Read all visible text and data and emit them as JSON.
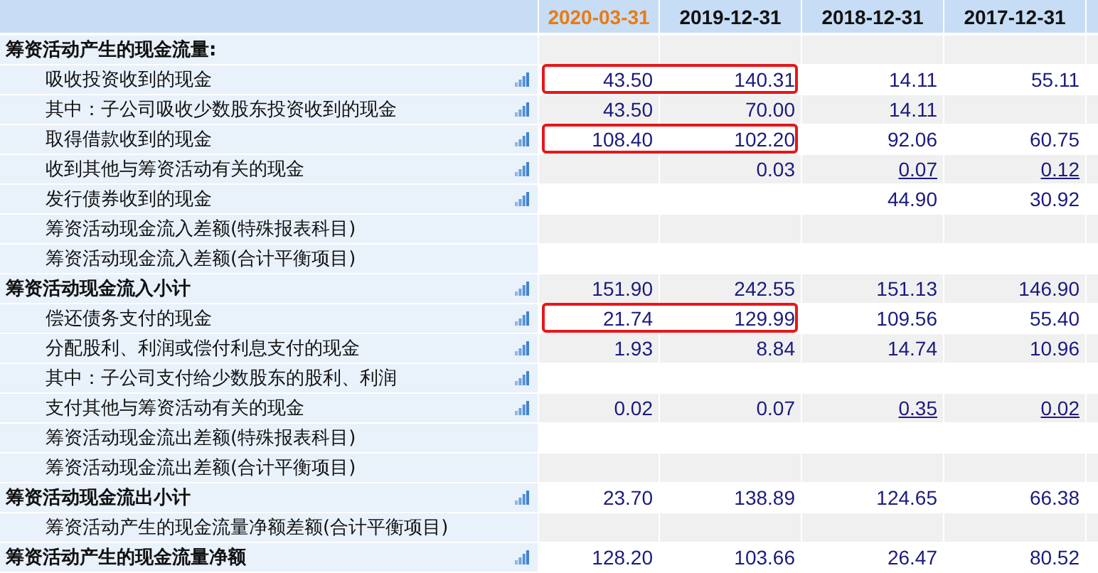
{
  "columns": [
    {
      "label": "2020-03-31",
      "selected": true
    },
    {
      "label": "2019-12-31",
      "selected": false
    },
    {
      "label": "2018-12-31",
      "selected": false
    },
    {
      "label": "2017-12-31",
      "selected": false
    }
  ],
  "rows": [
    {
      "kind": "section",
      "label": "筹资活动产生的现金流量:",
      "chart_icon": false,
      "highlighted": false,
      "cells": [
        null,
        null,
        null,
        null
      ]
    },
    {
      "kind": "item",
      "label": "吸收投资收到的现金",
      "chart_icon": true,
      "highlighted": true,
      "cells": [
        {
          "text": "43.50",
          "link": false
        },
        {
          "text": "140.31",
          "link": false
        },
        {
          "text": "14.11",
          "link": false
        },
        {
          "text": "55.11",
          "link": false
        }
      ]
    },
    {
      "kind": "item",
      "label": "其中：子公司吸收少数股东投资收到的现金",
      "chart_icon": true,
      "highlighted": false,
      "cells": [
        {
          "text": "43.50",
          "link": false
        },
        {
          "text": "70.00",
          "link": false
        },
        {
          "text": "14.11",
          "link": false
        },
        null
      ]
    },
    {
      "kind": "item",
      "label": "取得借款收到的现金",
      "chart_icon": true,
      "highlighted": true,
      "cells": [
        {
          "text": "108.40",
          "link": false
        },
        {
          "text": "102.20",
          "link": false
        },
        {
          "text": "92.06",
          "link": false
        },
        {
          "text": "60.75",
          "link": false
        }
      ]
    },
    {
      "kind": "item",
      "label": "收到其他与筹资活动有关的现金",
      "chart_icon": true,
      "highlighted": false,
      "cells": [
        null,
        {
          "text": "0.03",
          "link": false
        },
        {
          "text": "0.07",
          "link": true
        },
        {
          "text": "0.12",
          "link": true
        }
      ]
    },
    {
      "kind": "item",
      "label": "发行债券收到的现金",
      "chart_icon": true,
      "highlighted": false,
      "cells": [
        null,
        null,
        {
          "text": "44.90",
          "link": false
        },
        {
          "text": "30.92",
          "link": false
        }
      ]
    },
    {
      "kind": "item",
      "label": "筹资活动现金流入差额(特殊报表科目)",
      "chart_icon": false,
      "highlighted": false,
      "cells": [
        null,
        null,
        null,
        null
      ]
    },
    {
      "kind": "item",
      "label": "筹资活动现金流入差额(合计平衡项目)",
      "chart_icon": false,
      "highlighted": false,
      "cells": [
        null,
        null,
        null,
        null
      ]
    },
    {
      "kind": "subtotal",
      "label": "筹资活动现金流入小计",
      "chart_icon": true,
      "highlighted": false,
      "cells": [
        {
          "text": "151.90",
          "link": false
        },
        {
          "text": "242.55",
          "link": false
        },
        {
          "text": "151.13",
          "link": false
        },
        {
          "text": "146.90",
          "link": false
        }
      ]
    },
    {
      "kind": "item",
      "label": "偿还债务支付的现金",
      "chart_icon": true,
      "highlighted": true,
      "cells": [
        {
          "text": "21.74",
          "link": false
        },
        {
          "text": "129.99",
          "link": false
        },
        {
          "text": "109.56",
          "link": false
        },
        {
          "text": "55.40",
          "link": false
        }
      ]
    },
    {
      "kind": "item",
      "label": "分配股利、利润或偿付利息支付的现金",
      "chart_icon": true,
      "highlighted": false,
      "cells": [
        {
          "text": "1.93",
          "link": false
        },
        {
          "text": "8.84",
          "link": false
        },
        {
          "text": "14.74",
          "link": false
        },
        {
          "text": "10.96",
          "link": false
        }
      ]
    },
    {
      "kind": "item",
      "label": "其中：子公司支付给少数股东的股利、利润",
      "chart_icon": true,
      "highlighted": false,
      "cells": [
        null,
        null,
        null,
        null
      ]
    },
    {
      "kind": "item",
      "label": "支付其他与筹资活动有关的现金",
      "chart_icon": true,
      "highlighted": false,
      "cells": [
        {
          "text": "0.02",
          "link": false
        },
        {
          "text": "0.07",
          "link": false
        },
        {
          "text": "0.35",
          "link": true
        },
        {
          "text": "0.02",
          "link": true
        }
      ]
    },
    {
      "kind": "item",
      "label": "筹资活动现金流出差额(特殊报表科目)",
      "chart_icon": false,
      "highlighted": false,
      "cells": [
        null,
        null,
        null,
        null
      ]
    },
    {
      "kind": "item",
      "label": "筹资活动现金流出差额(合计平衡项目)",
      "chart_icon": false,
      "highlighted": false,
      "cells": [
        null,
        null,
        null,
        null
      ]
    },
    {
      "kind": "subtotal",
      "label": "筹资活动现金流出小计",
      "chart_icon": true,
      "highlighted": false,
      "cells": [
        {
          "text": "23.70",
          "link": false
        },
        {
          "text": "138.89",
          "link": false
        },
        {
          "text": "124.65",
          "link": false
        },
        {
          "text": "66.38",
          "link": false
        }
      ]
    },
    {
      "kind": "item",
      "label": "筹资活动产生的现金流量净额差额(合计平衡项目)",
      "chart_icon": false,
      "highlighted": false,
      "cells": [
        null,
        null,
        null,
        null
      ]
    },
    {
      "kind": "subtotal",
      "label": "筹资活动产生的现金流量净额",
      "chart_icon": true,
      "highlighted": false,
      "cells": [
        {
          "text": "128.20",
          "link": false
        },
        {
          "text": "103.66",
          "link": false
        },
        {
          "text": "26.47",
          "link": false
        },
        {
          "text": "80.52",
          "link": false
        }
      ]
    }
  ]
}
